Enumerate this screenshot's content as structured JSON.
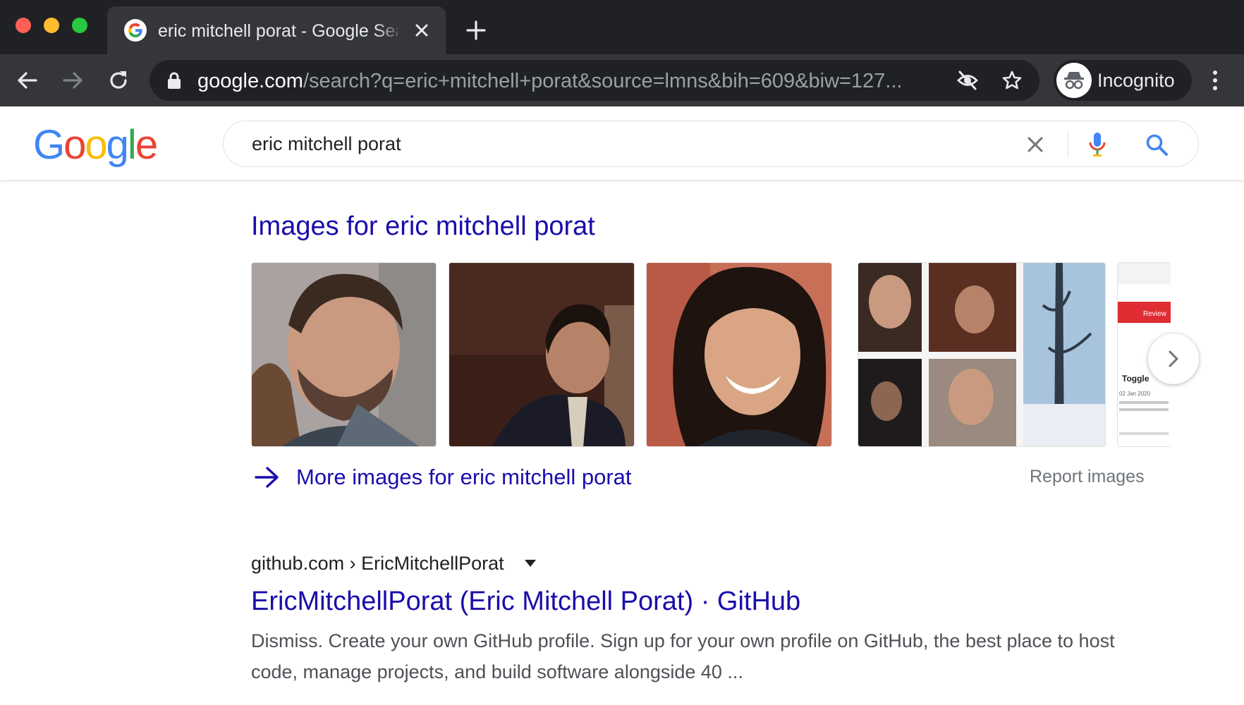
{
  "browser": {
    "tab_title": "eric mitchell porat - Google Search",
    "url_host": "google.com",
    "url_path": "/search?q=eric+mitchell+porat&source=lmns&bih=609&biw=127...",
    "profile_label": "Incognito"
  },
  "search": {
    "logo_letters": [
      "G",
      "o",
      "o",
      "g",
      "l",
      "e"
    ],
    "logo_colors": [
      "#4285F4",
      "#EA4335",
      "#FBBC05",
      "#4285F4",
      "#34A853",
      "#EA4335"
    ],
    "query": "eric mitchell porat"
  },
  "images": {
    "heading": "Images for eric mitchell porat",
    "more_label": "More images for eric mitchell porat",
    "report_label": "Report images",
    "thumb5_texts": [
      "Toggle",
      "02 Jan 2020",
      "Review"
    ]
  },
  "result": {
    "breadcrumb": "github.com › EricMitchellPorat",
    "title": "EricMitchellPorat (Eric Mitchell Porat) · GitHub",
    "snippet": "Dismiss. Create your own GitHub profile. Sign up for your own profile on GitHub, the best place to host code, manage projects, and build software alongside 40 ..."
  },
  "colors": {
    "link": "#1a0dab",
    "chrome_dark": "#202124",
    "chrome_toolbar": "#35363a"
  }
}
